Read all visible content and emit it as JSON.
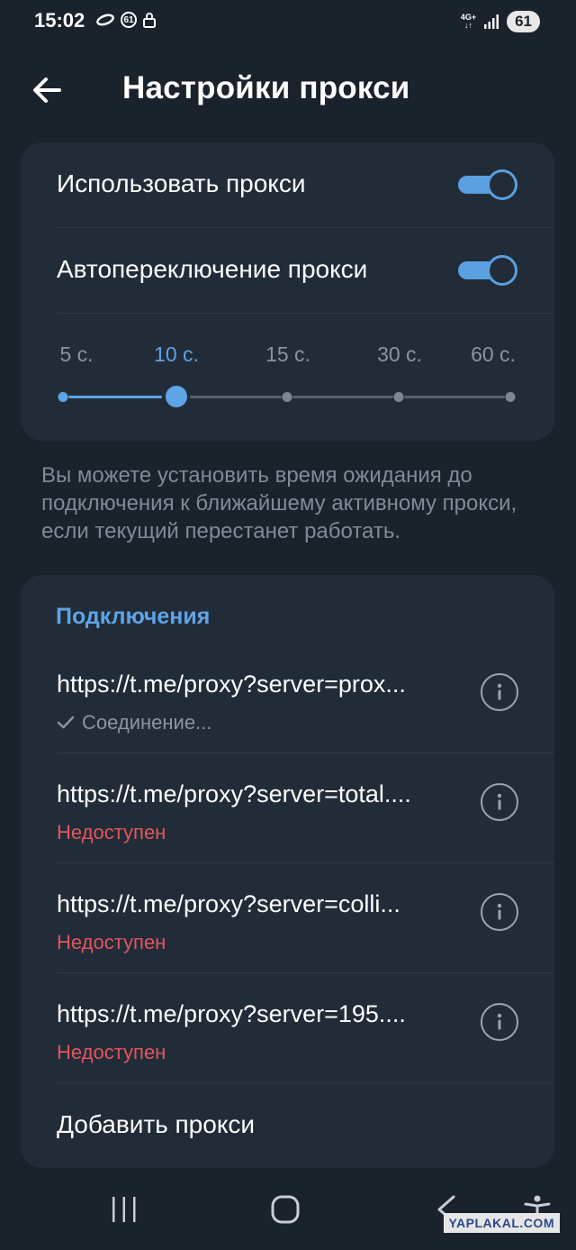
{
  "status_bar": {
    "time": "15:02",
    "badge": "61",
    "network": "4G+",
    "battery": "61"
  },
  "header": {
    "title": "Настройки прокси",
    "back_icon": "arrow-left-icon"
  },
  "settings": {
    "use_proxy": {
      "label": "Использовать прокси",
      "enabled": true
    },
    "auto_switch": {
      "label": "Автопереключение прокси",
      "enabled": true
    },
    "timeout_slider": {
      "options": [
        "5 с.",
        "10 с.",
        "15 с.",
        "30 с.",
        "60 с."
      ],
      "selected": "10 с.",
      "selected_index": 1
    },
    "hint": "Вы можете установить время ожидания до подключения к ближайшему активному прокси, если текущий перестанет работать."
  },
  "connections": {
    "title": "Подключения",
    "items": [
      {
        "url": "https://t.me/proxy?server=prox...",
        "status": "Соединение...",
        "status_type": "ok",
        "check_icon": "checkmark-icon"
      },
      {
        "url": "https://t.me/proxy?server=total....",
        "status": "Недоступен",
        "status_type": "err"
      },
      {
        "url": "https://t.me/proxy?server=colli...",
        "status": "Недоступен",
        "status_type": "err"
      },
      {
        "url": "https://t.me/proxy?server=195....",
        "status": "Недоступен",
        "status_type": "err"
      }
    ],
    "add_label": "Добавить прокси"
  },
  "nav": {
    "recent_icon": "recent-apps-icon",
    "home_icon": "home-icon",
    "back_icon": "back-chevron-icon",
    "accessibility_icon": "accessibility-icon"
  },
  "watermark": "YAPLAKAL.COM",
  "colors": {
    "background": "#1a222c",
    "card": "#222c38",
    "accent": "#5ea4e6",
    "error": "#e2555e"
  }
}
